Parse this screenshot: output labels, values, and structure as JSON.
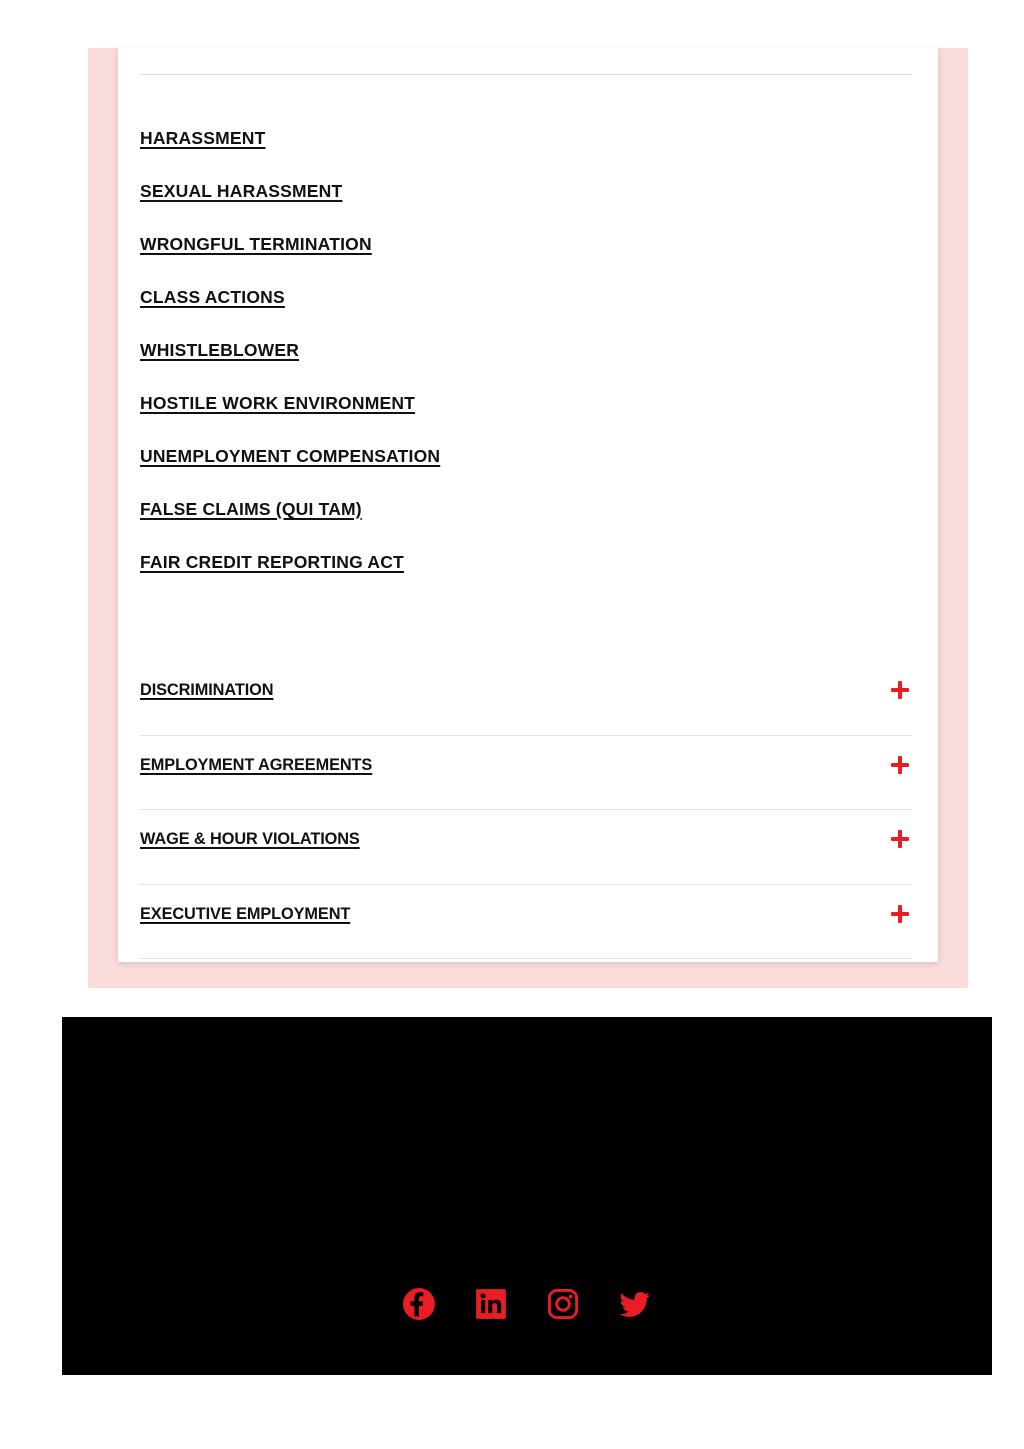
{
  "page": {
    "background_color": "#ffffff",
    "card_background": "#ffffff",
    "frame_color": "#fbdcdd",
    "accent_color": "#ea1d25",
    "footer_background": "#000000",
    "divider_color": "#e2e2e2"
  },
  "practice_links": [
    {
      "label": "HARASSMENT"
    },
    {
      "label": "SEXUAL HARASSMENT"
    },
    {
      "label": "WRONGFUL TERMINATION"
    },
    {
      "label": "CLASS ACTIONS"
    },
    {
      "label": "WHISTLEBLOWER"
    },
    {
      "label": "HOSTILE WORK ENVIRONMENT"
    },
    {
      "label": "UNEMPLOYMENT COMPENSATION"
    },
    {
      "label": "FALSE CLAIMS (QUI TAM)"
    },
    {
      "label": "FAIR CREDIT REPORTING ACT"
    }
  ],
  "accordion": {
    "expand_icon": "plus-icon",
    "items": [
      {
        "label": "DISCRIMINATION",
        "expanded": "false"
      },
      {
        "label": "EMPLOYMENT AGREEMENTS",
        "expanded": "false"
      },
      {
        "label": "WAGE & HOUR VIOLATIONS",
        "expanded": "false"
      },
      {
        "label": "EXECUTIVE EMPLOYMENT",
        "expanded": "false"
      }
    ]
  },
  "footer": {
    "social": [
      {
        "name": "facebook",
        "icon": "facebook-icon"
      },
      {
        "name": "linkedin",
        "icon": "linkedin-icon"
      },
      {
        "name": "instagram",
        "icon": "instagram-icon"
      },
      {
        "name": "twitter",
        "icon": "twitter-icon"
      }
    ]
  }
}
